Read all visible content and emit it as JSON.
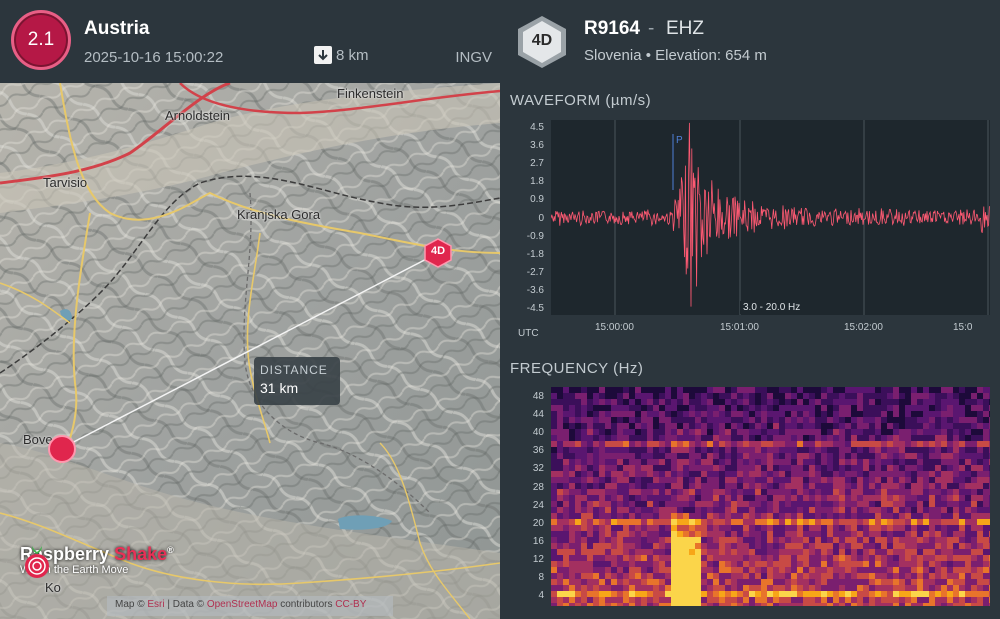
{
  "event": {
    "magnitude": "2.1",
    "region": "Austria",
    "time": "2025-10-16 15:00:22",
    "depth": "8 km",
    "agency": "INGV"
  },
  "map": {
    "towns": [
      "Finkenstein",
      "Arnoldstein",
      "Tarvisio",
      "Kranjska Gora",
      "Bove",
      "Ko"
    ],
    "distance_label": "DISTANCE",
    "distance_value": "31 km",
    "station_marker": "4D",
    "brand_part1": "Raspberry",
    "brand_part2": "Shake",
    "brand_mark": "®",
    "brand_tagline": "Watch the Earth Move",
    "attribution_prefix": "Map ©",
    "attribution_link1": "Esri",
    "attribution_mid": " | Data ©",
    "attribution_link2": "OpenStreetMap",
    "attribution_suffix": " contributors",
    "attribution_link3": "CC-BY"
  },
  "station": {
    "hex_label": "4D",
    "code": "R9164",
    "separator": "-",
    "channel": "EHZ",
    "info": "Slovenia • Elevation: 654 m"
  },
  "waveform": {
    "title": "WAVEFORM (µm/s)",
    "y_ticks": [
      "4.5",
      "3.6",
      "2.7",
      "1.8",
      "0.9",
      "0",
      "-0.9",
      "-1.8",
      "-2.7",
      "-3.6",
      "-4.5"
    ],
    "x_ticks": [
      "15:00:00",
      "15:01:00",
      "15:02:00",
      "15:0"
    ],
    "utc_label": "UTC",
    "filter": "3.0 - 20.0 Hz",
    "p_label": "P",
    "color": "#ff5a73"
  },
  "frequency": {
    "title": "FREQUENCY (Hz)",
    "y_ticks": [
      "48",
      "44",
      "40",
      "36",
      "32",
      "28",
      "24",
      "20",
      "16",
      "12",
      "8",
      "4"
    ]
  },
  "chart_data": [
    {
      "type": "line",
      "title": "WAVEFORM (µm/s)",
      "xlabel": "UTC",
      "ylabel": "µm/s",
      "x_ticks": [
        "15:00:00",
        "15:01:00",
        "15:02:00"
      ],
      "ylim": [
        -4.5,
        4.5
      ],
      "p_arrival": "15:00:28",
      "peak_time": "15:00:35",
      "peak_amplitude": 4.5,
      "noise_amplitude": 0.3,
      "filter": "3.0 - 20.0 Hz"
    },
    {
      "type": "heatmap",
      "title": "FREQUENCY (Hz)",
      "ylabel": "Hz",
      "ylim": [
        0,
        50
      ],
      "energy_concentration": "2 - 20 Hz around 15:00:30 - 15:00:40"
    }
  ]
}
